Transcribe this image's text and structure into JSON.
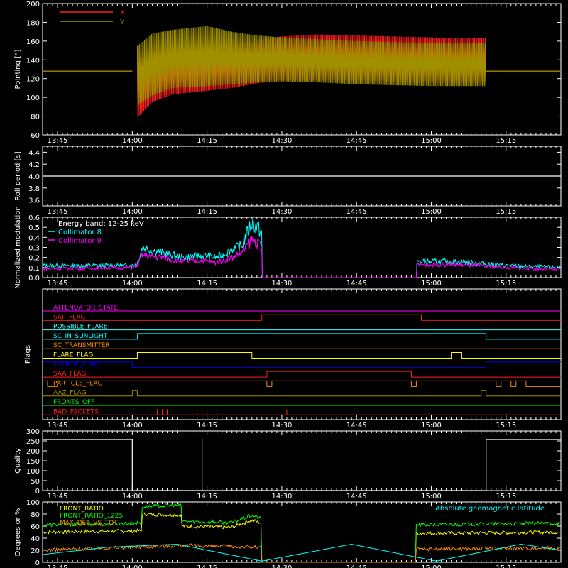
{
  "colors": {
    "background": "#000000",
    "foreground": "#ffffff",
    "red": "#ff2020",
    "olive": "#a09000",
    "cyan": "#00ffff",
    "magenta": "#ff00ff",
    "yellow": "#ffff00",
    "orange": "#ff8c00",
    "green": "#00ff00",
    "blue": "#0000ff",
    "purple": "#a020f0",
    "light_cyan": "#40ffff",
    "dark_green": "#20c000"
  },
  "chart_data": [
    {
      "id": "pointing",
      "type": "line",
      "ylabel": "Pointing [\"]",
      "ylim": [
        60,
        200
      ],
      "yticks": [
        "60",
        "80",
        "100",
        "120",
        "140",
        "160",
        "180",
        "200"
      ],
      "xlim": [
        "13:42",
        "15:26"
      ],
      "xticks": [
        "13:45",
        "14:00",
        "14:15",
        "14:30",
        "14:45",
        "15:00",
        "15:15"
      ],
      "legend_position": "top-left",
      "series": [
        {
          "name": "X",
          "color_key": "red",
          "x": [
            "13:42",
            "14:00",
            "14:01",
            "14:04",
            "14:08",
            "14:15",
            "14:20",
            "14:25",
            "14:30",
            "14:37",
            "14:45",
            "14:52",
            "15:00",
            "15:05",
            "15:11",
            "15:11",
            "15:26"
          ],
          "y_min": [
            128,
            128,
            78,
            95,
            103,
            107,
            110,
            115,
            118,
            119,
            118,
            117,
            116,
            116,
            116,
            128,
            128
          ],
          "y_max": [
            128,
            128,
            138,
            150,
            152,
            155,
            158,
            160,
            165,
            167,
            166,
            165,
            164,
            163,
            163,
            128,
            128
          ]
        },
        {
          "name": "Y",
          "color_key": "olive",
          "x": [
            "13:42",
            "14:00",
            "14:01",
            "14:04",
            "14:08",
            "14:15",
            "14:20",
            "14:25",
            "14:30",
            "14:37",
            "14:45",
            "14:52",
            "15:00",
            "15:05",
            "15:11",
            "15:11",
            "15:26"
          ],
          "y_min": [
            128,
            128,
            92,
            102,
            110,
            112,
            114,
            116,
            117,
            116,
            114,
            113,
            112,
            112,
            112,
            128,
            128
          ],
          "y_max": [
            128,
            128,
            155,
            168,
            172,
            176,
            170,
            166,
            164,
            162,
            160,
            159,
            158,
            158,
            158,
            128,
            128
          ]
        }
      ]
    },
    {
      "id": "roll",
      "type": "line",
      "ylabel": "Roll period [s]",
      "ylim": [
        3.5,
        4.5
      ],
      "yticks": [
        "3.6",
        "3.8",
        "4.0",
        "4.2",
        "4.4"
      ],
      "xlim": [
        "13:42",
        "15:26"
      ],
      "xticks": [
        "13:45",
        "14:00",
        "14:15",
        "14:30",
        "14:45",
        "15:00",
        "15:15"
      ],
      "series": [
        {
          "color_key": "foreground",
          "x": [
            "13:42",
            "15:26"
          ],
          "y": [
            4.0,
            4.0
          ]
        }
      ]
    },
    {
      "id": "modulation",
      "type": "line",
      "ylabel": "Normalized modulation",
      "ylim": [
        0,
        0.6
      ],
      "yticks": [
        "0.0",
        "0.1",
        "0.2",
        "0.3",
        "0.4",
        "0.5",
        "0.6"
      ],
      "xlim": [
        "13:42",
        "15:26"
      ],
      "xticks": [
        "13:45",
        "14:00",
        "14:15",
        "14:30",
        "14:45",
        "15:00",
        "15:15"
      ],
      "annotation": "Energy band: 12-25 keV",
      "legend_position": "top-left",
      "series": [
        {
          "name": "Collimator 8",
          "color_key": "cyan",
          "x": [
            "13:42",
            "14:00",
            "14:01",
            "14:02",
            "14:06",
            "14:10",
            "14:14",
            "14:17",
            "14:20",
            "14:22",
            "14:24",
            "14:25",
            "14:26",
            "14:26",
            "14:57",
            "14:57",
            "15:05",
            "15:15",
            "15:26"
          ],
          "y": [
            0.12,
            0.12,
            0.14,
            0.3,
            0.25,
            0.2,
            0.22,
            0.2,
            0.28,
            0.32,
            0.55,
            0.5,
            0.45,
            0.0,
            0.0,
            0.16,
            0.16,
            0.12,
            0.1
          ]
        },
        {
          "name": "Collimator 9",
          "color_key": "magenta",
          "x": [
            "13:42",
            "14:00",
            "14:01",
            "14:02",
            "14:06",
            "14:10",
            "14:14",
            "14:17",
            "14:20",
            "14:22",
            "14:24",
            "14:25",
            "14:26",
            "14:26",
            "14:57",
            "14:57",
            "15:05",
            "15:15",
            "15:26"
          ],
          "y": [
            0.09,
            0.1,
            0.12,
            0.22,
            0.2,
            0.16,
            0.17,
            0.15,
            0.2,
            0.25,
            0.38,
            0.35,
            0.3,
            0.0,
            0.0,
            0.13,
            0.13,
            0.1,
            0.08
          ]
        }
      ]
    },
    {
      "id": "flags",
      "type": "step",
      "ylabel": "Flags",
      "xlim": [
        "13:42",
        "15:26"
      ],
      "xticks": [
        "13:45",
        "14:00",
        "14:15",
        "14:30",
        "14:45",
        "15:00",
        "15:15"
      ],
      "flags": [
        {
          "name": "ATTENUATOR_STATE",
          "color_key": "magenta",
          "x": [
            "13:42",
            "15:26"
          ],
          "y": [
            0,
            0
          ]
        },
        {
          "name": "SAP_FLAG",
          "color_key": "red",
          "x": [
            "13:42",
            "14:26",
            "14:26",
            "14:58",
            "14:58",
            "15:26"
          ],
          "y": [
            0,
            0,
            1,
            1,
            0,
            0
          ]
        },
        {
          "name": "POSSIBLE_FLARE",
          "color_key": "light_cyan",
          "x": [
            "13:42",
            "15:26"
          ],
          "y": [
            0,
            0
          ]
        },
        {
          "name": "SC_IN_SUNLIGHT",
          "color_key": "cyan",
          "x": [
            "13:42",
            "14:01",
            "14:01",
            "15:11",
            "15:11",
            "15:26"
          ],
          "y": [
            0,
            0,
            1,
            1,
            0,
            0
          ]
        },
        {
          "name": "SC_TRANSMITTER",
          "color_key": "orange",
          "x": [
            "13:42",
            "15:26"
          ],
          "y": [
            0,
            0
          ]
        },
        {
          "name": "FLARE_FLAG",
          "color_key": "yellow",
          "x": [
            "13:42",
            "14:01",
            "14:01",
            "14:24",
            "14:24",
            "15:04",
            "15:04",
            "15:06",
            "15:06",
            "15:26"
          ],
          "y": [
            0,
            0,
            1,
            1,
            0,
            0,
            1,
            1,
            0,
            0
          ]
        },
        {
          "name": "ECLIPSE_FLAG",
          "color_key": "blue",
          "x": [
            "13:42",
            "14:00",
            "14:00",
            "15:11",
            "15:11",
            "15:26"
          ],
          "y": [
            1,
            1,
            0,
            0,
            1,
            1
          ]
        },
        {
          "name": "SAA_FLAG",
          "color_key": "red",
          "x": [
            "13:42",
            "14:27",
            "14:27",
            "14:56",
            "14:56",
            "15:26"
          ],
          "y": [
            0,
            0,
            1,
            1,
            0,
            0
          ]
        },
        {
          "name": "PARTICLE_FLAG",
          "color_key": "orange",
          "x": [
            "13:42",
            "13:43",
            "13:43",
            "13:45",
            "13:45",
            "13:48",
            "13:48",
            "14:27",
            "14:27",
            "14:28",
            "14:28",
            "14:56",
            "14:56",
            "14:57",
            "14:57",
            "15:13",
            "15:13",
            "15:14",
            "15:14",
            "15:16",
            "15:16",
            "15:17",
            "15:17",
            "15:19",
            "15:19",
            "15:26"
          ],
          "y": [
            1,
            1,
            0,
            0,
            1,
            1,
            1,
            1,
            0,
            0,
            1,
            1,
            0,
            0,
            1,
            1,
            0,
            0,
            1,
            1,
            0,
            0,
            1,
            1,
            0,
            0
          ]
        },
        {
          "name": "AAZ_FLAG",
          "color_key": "olive",
          "x": [
            "13:42",
            "14:00",
            "14:00",
            "14:01",
            "14:01",
            "15:10",
            "15:10",
            "15:11",
            "15:11",
            "15:26"
          ],
          "y": [
            0,
            0,
            1,
            1,
            0,
            0,
            1,
            1,
            0,
            0
          ]
        },
        {
          "name": "FRONTS_OFF",
          "color_key": "green",
          "x": [
            "13:42",
            "15:26"
          ],
          "y": [
            0,
            0
          ]
        },
        {
          "name": "BAD_PACKETS",
          "color_key": "red",
          "spikes": [
            "14:05",
            "14:06",
            "14:07",
            "14:07",
            "14:12",
            "14:13",
            "14:14",
            "14:15",
            "14:17",
            "14:31"
          ]
        }
      ]
    },
    {
      "id": "quality",
      "type": "line",
      "ylabel": "Quality",
      "ylim": [
        0,
        300
      ],
      "yticks": [
        "0",
        "50",
        "100",
        "150",
        "200",
        "250",
        "300"
      ],
      "xlim": [
        "13:42",
        "15:26"
      ],
      "xticks": [
        "13:45",
        "14:00",
        "14:15",
        "14:30",
        "14:45",
        "15:00",
        "15:15"
      ],
      "series": [
        {
          "color_key": "foreground",
          "x": [
            "13:42",
            "14:00",
            "14:00",
            "14:14",
            "14:14",
            "14:14",
            "14:14",
            "15:11",
            "15:11",
            "15:26"
          ],
          "y": [
            257,
            257,
            0,
            0,
            257,
            257,
            0,
            0,
            257,
            257
          ]
        }
      ]
    },
    {
      "id": "ratios",
      "type": "line",
      "ylabel": "Degrees or %",
      "ylim": [
        0,
        100
      ],
      "yticks": [
        "0",
        "20",
        "40",
        "60",
        "80",
        "100"
      ],
      "xlim": [
        "13:42",
        "15:26"
      ],
      "xticks": [
        "13:45",
        "14:00",
        "14:15",
        "14:30",
        "14:45",
        "15:00",
        "15:15"
      ],
      "legend_position": "top-left",
      "series": [
        {
          "name": "FRONT_RATIO",
          "color_key": "yellow",
          "x": [
            "13:42",
            "14:02",
            "14:02",
            "14:10",
            "14:10",
            "14:20",
            "14:24",
            "14:26",
            "14:26",
            "14:57",
            "14:57",
            "15:26"
          ],
          "y": [
            50,
            52,
            80,
            78,
            60,
            58,
            70,
            65,
            0,
            0,
            48,
            50
          ]
        },
        {
          "name": "FRONT_RATIO_1225",
          "color_key": "green",
          "x": [
            "13:42",
            "14:02",
            "14:02",
            "14:10",
            "14:10",
            "14:20",
            "14:24",
            "14:26",
            "14:26",
            "14:57",
            "14:57",
            "15:26"
          ],
          "y": [
            62,
            65,
            92,
            95,
            68,
            66,
            78,
            72,
            0,
            0,
            62,
            65
          ]
        },
        {
          "name": "MAX_DET_VS_TOT",
          "color_key": "orange",
          "x": [
            "13:42",
            "14:10",
            "14:26",
            "14:26",
            "14:57",
            "14:57",
            "15:26"
          ],
          "y": [
            20,
            28,
            25,
            0,
            0,
            22,
            24
          ]
        },
        {
          "name": "Absolute geomagnetic latitude",
          "color_key": "cyan",
          "x": [
            "13:42",
            "13:55",
            "14:09",
            "14:26",
            "14:44",
            "15:01",
            "15:18",
            "15:26"
          ],
          "y": [
            13,
            25,
            30,
            2,
            30,
            2,
            30,
            20
          ]
        }
      ]
    }
  ]
}
